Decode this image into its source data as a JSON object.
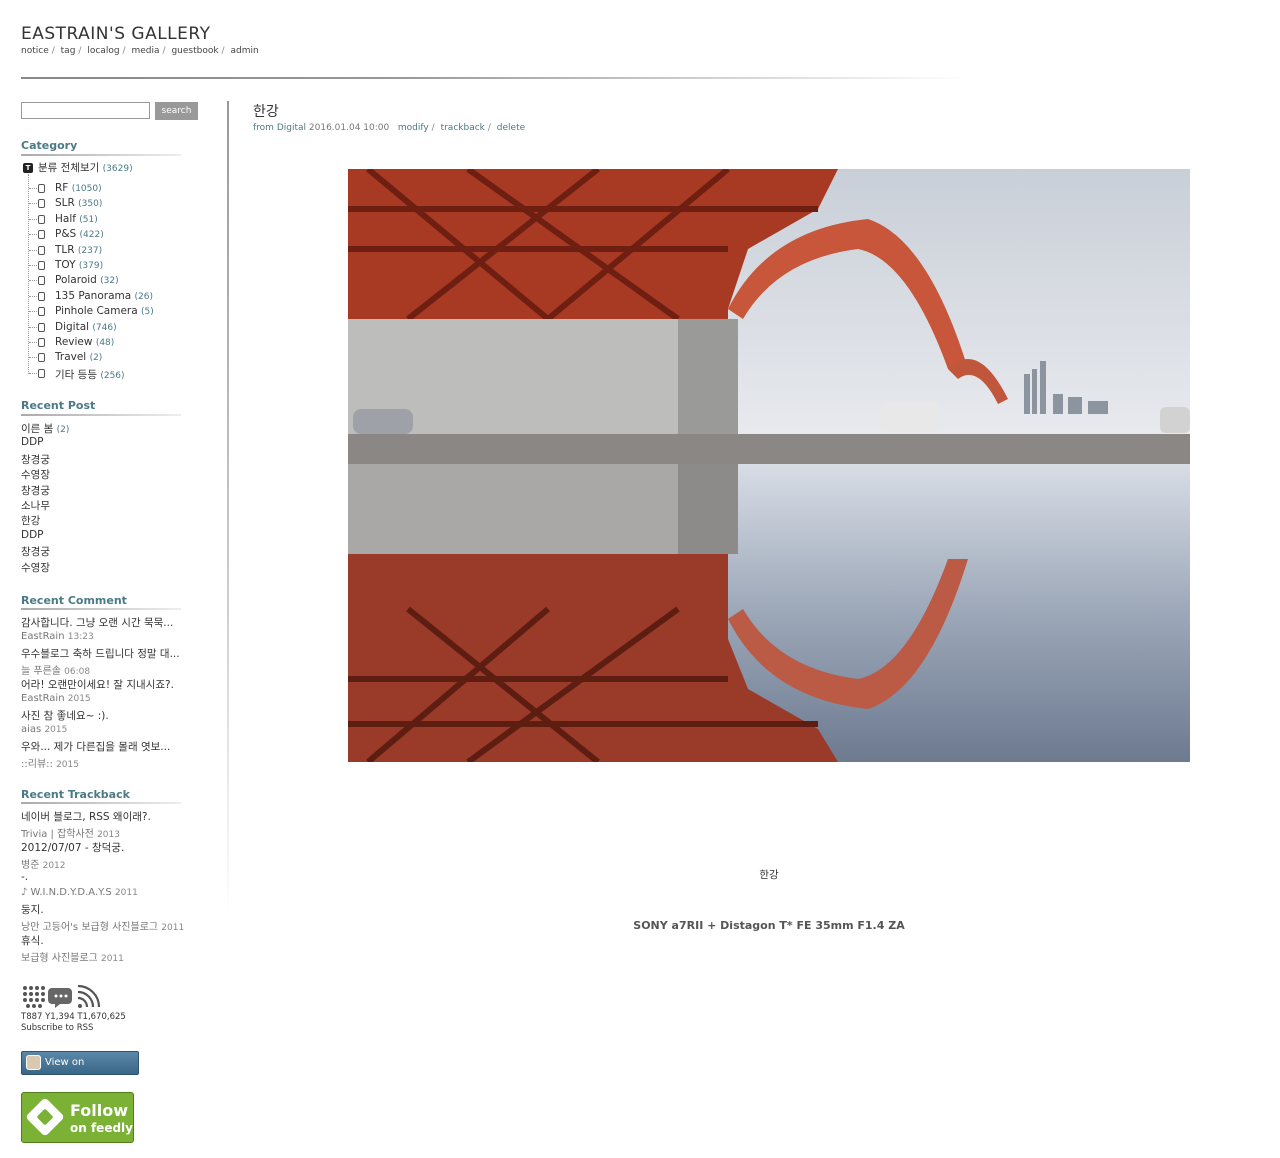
{
  "site": {
    "title": "EASTRAIN'S GALLERY",
    "nav": [
      "notice",
      "tag",
      "localog",
      "media",
      "guestbook",
      "admin"
    ]
  },
  "search": {
    "value": "",
    "button": "search"
  },
  "category": {
    "title": "Category",
    "root": {
      "label": "분류 전체보기",
      "count": "(3629)"
    },
    "items": [
      {
        "label": "RF",
        "count": "(1050)"
      },
      {
        "label": "SLR",
        "count": "(350)"
      },
      {
        "label": "Half",
        "count": "(51)"
      },
      {
        "label": "P&S",
        "count": "(422)"
      },
      {
        "label": "TLR",
        "count": "(237)"
      },
      {
        "label": "TOY",
        "count": "(379)"
      },
      {
        "label": "Polaroid",
        "count": "(32)"
      },
      {
        "label": "135 Panorama",
        "count": "(26)"
      },
      {
        "label": "Pinhole Camera",
        "count": "(5)"
      },
      {
        "label": "Digital",
        "count": "(746)"
      },
      {
        "label": "Review",
        "count": "(48)"
      },
      {
        "label": "Travel",
        "count": "(2)"
      },
      {
        "label": "기타 등등",
        "count": "(256)"
      }
    ]
  },
  "recent_post": {
    "title": "Recent Post",
    "items": [
      {
        "label": "이른 봄",
        "count": "(2)"
      },
      {
        "label": "DDP",
        "count": ""
      },
      {
        "label": "창경궁",
        "count": ""
      },
      {
        "label": "수영장",
        "count": ""
      },
      {
        "label": "창경궁",
        "count": ""
      },
      {
        "label": "소나무",
        "count": ""
      },
      {
        "label": "한강",
        "count": ""
      },
      {
        "label": "DDP",
        "count": ""
      },
      {
        "label": "창경궁",
        "count": ""
      },
      {
        "label": "수영장",
        "count": ""
      }
    ]
  },
  "recent_comment": {
    "title": "Recent Comment",
    "items": [
      {
        "text": "감사합니다. 그냥 오랜 시간 묵묵...",
        "author": "EastRain",
        "time": "13:23"
      },
      {
        "text": "우수블로그 축하 드립니다 정말 대...",
        "author": "늘 푸른솔",
        "time": "06:08"
      },
      {
        "text": "어라! 오랜만이세요! 잘 지내시죠?.",
        "author": "EastRain",
        "time": "2015"
      },
      {
        "text": "사진 참 좋네요~ :).",
        "author": "aias",
        "time": "2015"
      },
      {
        "text": "우와... 제가 다른집을 몰래 엿보...",
        "author": "::리뷰::",
        "time": "2015"
      }
    ]
  },
  "recent_trackback": {
    "title": "Recent Trackback",
    "items": [
      {
        "text": "네이버 블로그, RSS 왜이래?.",
        "source": "Trivia | 잡학사전",
        "time": "2013"
      },
      {
        "text": "2012/07/07 - 창덕궁.",
        "source": "병준",
        "time": "2012"
      },
      {
        "text": "-.",
        "source": "♪ W.I.N.D.Y.D.A.Y.S",
        "time": "2011"
      },
      {
        "text": "둥지.",
        "source": "낭만 고등어's 보급형 사진블로그",
        "time": "2011"
      },
      {
        "text": "휴식.",
        "source": "보급형 사진블로그",
        "time": "2011"
      }
    ]
  },
  "footer_side": {
    "icons": [
      "tag-cloud-icon",
      "guestbook-bubble-icon",
      "rss-icon"
    ],
    "counter": "T887 Y1,394 T1,670,625",
    "subscribe": "Subscribe to RSS",
    "instagram": "View on Instagram",
    "feedly_line1": "Follow",
    "feedly_line2": "on feedly"
  },
  "post": {
    "title": "한강",
    "from_label": "from",
    "category": "Digital",
    "date": "2016.01.04 10:00",
    "actions": [
      "modify",
      "trackback",
      "delete"
    ],
    "caption": "한강",
    "camera": "SONY a7RII + Distagon T* FE 35mm F1.4 ZA"
  },
  "colors": {
    "accent": "#4a7a86",
    "feedly": "#7bb236",
    "instagram": "#4a7696"
  }
}
